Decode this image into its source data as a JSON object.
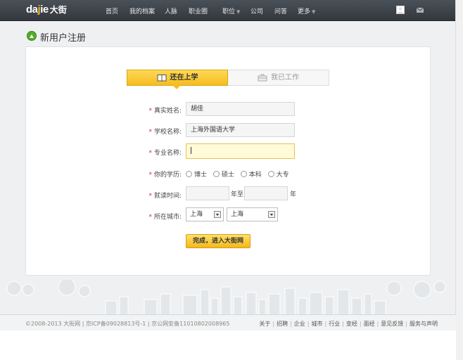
{
  "logo": {
    "latin_a": "da",
    "latin_b": "j",
    "latin_c": "ie",
    "chinese": "大街"
  },
  "nav": {
    "items": [
      "首页",
      "我的档案",
      "人脉",
      "职业圈",
      "职位",
      "公司",
      "问答",
      "更多"
    ]
  },
  "page": {
    "title": "新用户注册"
  },
  "tabs": {
    "school": "还在上学",
    "work": "我已工作"
  },
  "form": {
    "name_label": "真实姓名:",
    "name_value": "胡佳",
    "school_label": "学校名称:",
    "school_value": "上海外国语大学",
    "major_label": "专业名称:",
    "major_value": "",
    "degree_label": "你的学历:",
    "degrees": [
      "博士",
      "硕士",
      "本科",
      "大专"
    ],
    "period_label": "就读时间:",
    "year_to": "年至",
    "year": "年",
    "city_label": "所在城市:",
    "province_value": "上海",
    "city_value": "上海",
    "required_mark": "*",
    "submit_label": "完成，进入大街网"
  },
  "footer": {
    "copyright": "©2008-2013 大街网 | 京ICP备09028813号-1 | 京公网安备11010802008965",
    "links": [
      "关于",
      "招聘",
      "企业",
      "城市",
      "行业",
      "变经",
      "面经",
      "意见反馈",
      "服务与声明"
    ]
  },
  "colors": {
    "accent": "#f5bd1e",
    "topbar": "#3b4047",
    "required": "#dd2222",
    "success": "#54a92a"
  }
}
